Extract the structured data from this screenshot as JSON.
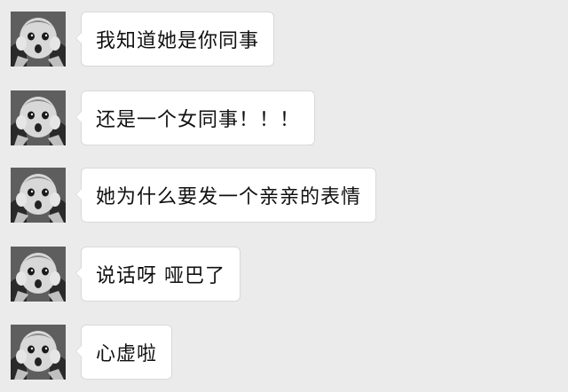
{
  "messages": [
    {
      "avatar_icon": "baby-avatar-icon",
      "text": "我知道她是你同事"
    },
    {
      "avatar_icon": "baby-avatar-icon",
      "text": "还是一个女同事！！！"
    },
    {
      "avatar_icon": "baby-avatar-icon",
      "text": "她为什么要发一个亲亲的表情"
    },
    {
      "avatar_icon": "baby-avatar-icon",
      "text": "说话呀 哑巴了"
    },
    {
      "avatar_icon": "baby-avatar-icon",
      "text": "心虚啦"
    }
  ],
  "colors": {
    "background": "#ebebeb",
    "bubble": "#ffffff",
    "bubble_border": "#d9d9d9",
    "text": "#111111"
  }
}
